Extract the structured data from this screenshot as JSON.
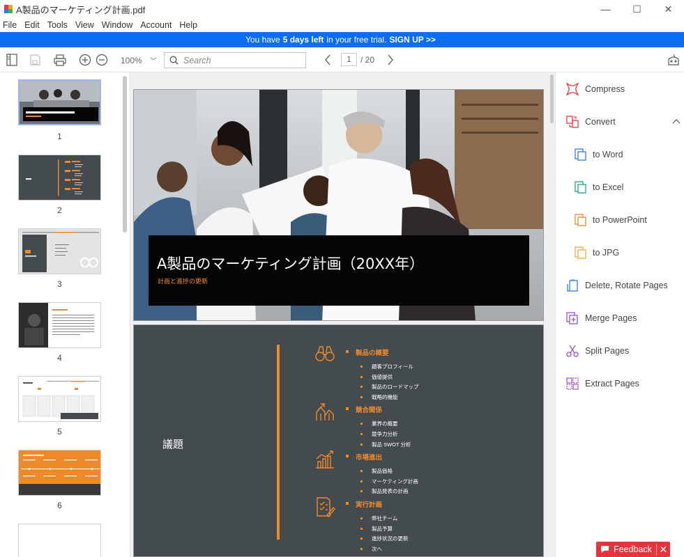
{
  "window": {
    "title": "A製品のマーケティング計画.pdf",
    "minimize": "—",
    "maximize": "☐",
    "close": "✕"
  },
  "menu": [
    "File",
    "Edit",
    "Tools",
    "View",
    "Window",
    "Account",
    "Help"
  ],
  "trial": {
    "prefix": "You have",
    "days": "5 days left",
    "suffix": "in your free trial.",
    "cta": "SIGN UP >>"
  },
  "toolbar": {
    "zoom": "100%",
    "search_placeholder": "Search",
    "current_page": "1",
    "total_pages": "/ 20"
  },
  "thumbnails": [
    "1",
    "2",
    "3",
    "4",
    "5",
    "6"
  ],
  "page1": {
    "title": "A製品のマーケティング計画（20XX年）",
    "subtitle": "計画と進捗の更新"
  },
  "page2": {
    "heading": "議題",
    "sections": [
      {
        "title": "製品の概要",
        "items": [
          "顧客プロフィール",
          "価値提供",
          "製品のロードマップ",
          "戦略的機能"
        ],
        "icon": "binoculars-icon"
      },
      {
        "title": "競合関係",
        "items": [
          "業界の概要",
          "競争力分析",
          "製品 SWOT 分析"
        ],
        "icon": "growth-arrows-icon"
      },
      {
        "title": "市場進出",
        "items": [
          "製品価格",
          "マーケティング計画",
          "製品発表の計画"
        ],
        "icon": "bar-chart-icon"
      },
      {
        "title": "実行計画",
        "items": [
          "弊社チーム",
          "製品予算",
          "進捗状況の更新",
          "次へ"
        ],
        "icon": "checklist-icon"
      }
    ]
  },
  "tools": {
    "compress": "Compress",
    "convert": "Convert",
    "to_word": "to Word",
    "to_excel": "to Excel",
    "to_powerpoint": "to PowerPoint",
    "to_jpg": "to JPG",
    "delete_rotate": "Delete, Rotate Pages",
    "merge": "Merge Pages",
    "split": "Split Pages",
    "extract": "Extract Pages"
  },
  "feedback": {
    "label": "Feedback",
    "close": "✕"
  },
  "colors": {
    "accent_blue": "#0b6ef0",
    "accent_orange": "#ef8a2a",
    "accent_red": "#e8323c",
    "slide_dark": "#444b4f"
  }
}
